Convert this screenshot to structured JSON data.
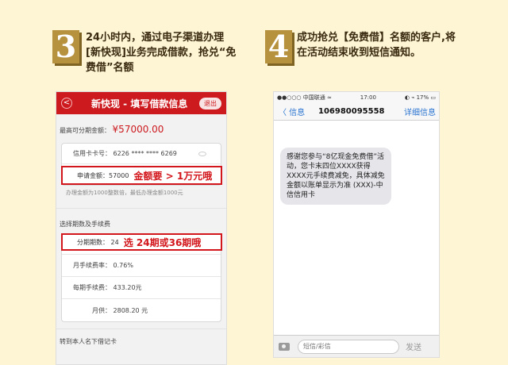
{
  "step3": {
    "number": "3",
    "text": "24小时内，通过电子渠道办理[新快现]业务完成借款，抢兑“免费借”名额"
  },
  "step4": {
    "number": "4",
    "text": "成功抢兑【免费借】名额的客户,将在活动结束收到短信通知。"
  },
  "phone1": {
    "back": "<",
    "title": "新快现 - 填写借款信息",
    "exit": "退出",
    "max_label": "最高可分期金额：",
    "max_value": "¥57000.00",
    "card_row": "信用卡卡号：  6226 **** **** 6269",
    "amount_label": "申请金额：57000",
    "amount_hint": "金额要 > 1万元哦",
    "amount_note": "办理金额为1000整数倍，最低办理金额1000元",
    "section": "选择期数及手续费",
    "period_label": "分期期数：  24",
    "period_hint": "选 24期或36期哦",
    "rate": "月手续费率：  0.76%",
    "fee": "每期手续费：  433.20元",
    "payment": "月供：  2808.20 元",
    "bottom_section": "转到本人名下借记卡"
  },
  "phone2": {
    "carrier": "●●○○○ 中国联通 ≈",
    "time": "17:00",
    "battery": "◐ ⌁ 17% ▭",
    "back": "〈 信息",
    "number": "106980095558",
    "details": "详细信息",
    "message": "感谢您参与“8亿现金免费借”活动，您卡末四位XXXX获得XXXX元手续费减免，具体减免金额以账单显示为准 (XXX)-中信信用卡",
    "input_placeholder": "短信/彩信",
    "send": "发送"
  }
}
